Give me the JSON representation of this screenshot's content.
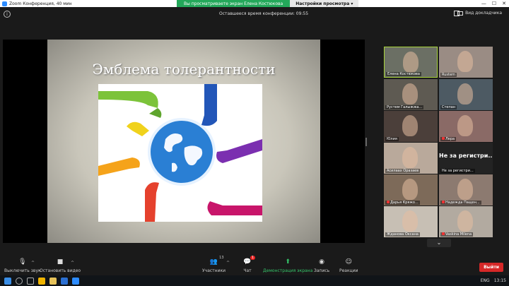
{
  "window": {
    "title": "Zoom Конференция, 40 мин"
  },
  "share_banner": {
    "viewing": "Вы просматриваете экран Елена Костюкова",
    "view_options": "Настройки просмотра"
  },
  "window_controls": {
    "minimize": "—",
    "maximize": "☐",
    "close": "✕"
  },
  "topbar": {
    "info": "i",
    "timer": "Оставшееся время конференции: 09:55",
    "view_label": "Вид докладчика"
  },
  "slide": {
    "title": "Эмблема толерантности"
  },
  "gallery": [
    {
      "name": "Елена Костюкова",
      "active": true,
      "muted": false,
      "color": "#6b6f64"
    },
    {
      "name": "Rustem",
      "active": false,
      "muted": false,
      "color": "#9a8c84"
    },
    {
      "name": "Рустем Галыжжа...",
      "active": false,
      "muted": false,
      "color": "#5e5a52"
    },
    {
      "name": "Степан",
      "active": false,
      "muted": false,
      "color": "#4d5a63"
    },
    {
      "name": "Юлия",
      "active": false,
      "muted": false,
      "color": "#4b3f3a"
    },
    {
      "name": "Лера",
      "active": false,
      "muted": true,
      "color": "#8a6a66"
    },
    {
      "name": "Асилаах Оразаев",
      "active": false,
      "muted": false,
      "color": "#b9a99b"
    },
    {
      "name": "Не за регистри...",
      "active": false,
      "muted": false,
      "color": "#232323",
      "name_only": true
    },
    {
      "name": "Дарья Кряжо...",
      "active": false,
      "muted": true,
      "color": "#7d6a59"
    },
    {
      "name": "Надежда Пащен...",
      "active": false,
      "muted": true,
      "color": "#8c7a70"
    },
    {
      "name": "Жданова Оксана",
      "active": false,
      "muted": false,
      "color": "#c7bfb4"
    },
    {
      "name": "Vaskina Milena",
      "active": false,
      "muted": true,
      "color": "#b2aaa0"
    }
  ],
  "toolbar": {
    "mute": "Выключить звук",
    "video": "Остановить видео",
    "participants": "Участники",
    "participants_count": "13",
    "chat": "Чат",
    "chat_badge": "1",
    "share": "Демонстрация экрана",
    "record": "Запись",
    "reactions": "Реакции",
    "exit": "Выйти"
  },
  "taskbar": {
    "lang": "ENG",
    "time": "13:15"
  },
  "colors": {
    "accent_green": "#23a85a",
    "exit_red": "#d62828"
  }
}
